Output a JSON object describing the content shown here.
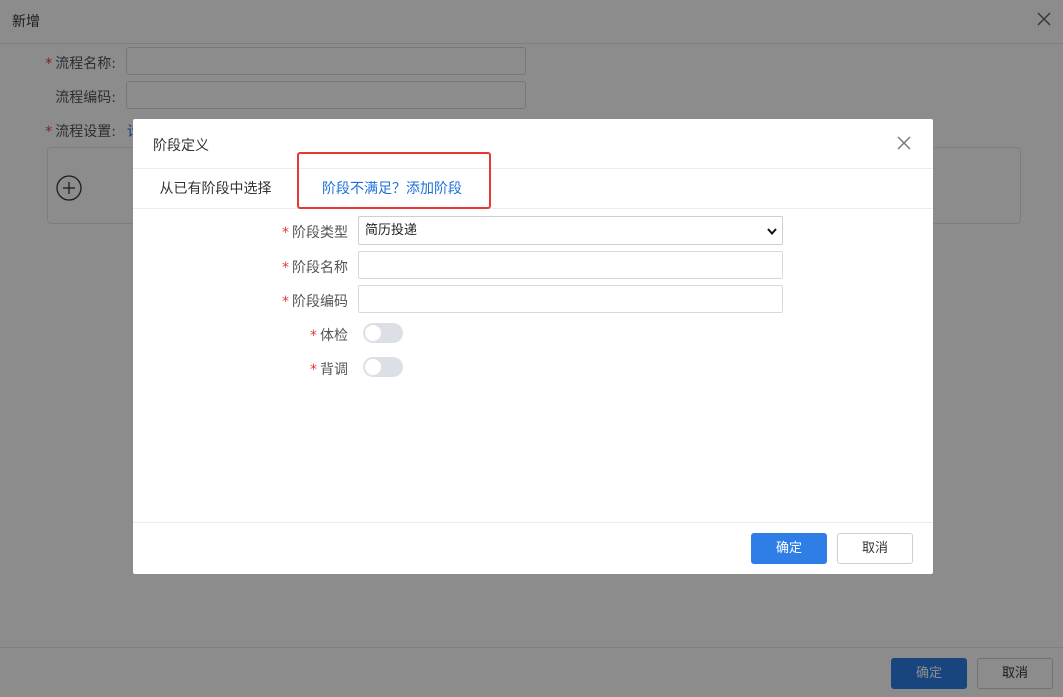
{
  "page": {
    "title": "新增",
    "fields": [
      {
        "label": "流程名称:",
        "required": true,
        "value": ""
      },
      {
        "label": "流程编码:",
        "required": false,
        "value": ""
      }
    ],
    "flow_settings_label": "流程设置:",
    "flow_settings_required": true,
    "flow_settings_link": "请",
    "confirm_label": "确定",
    "cancel_label": "取消"
  },
  "dialog": {
    "title": "阶段定义",
    "tabs": [
      {
        "label": "从已有阶段中选择"
      },
      {
        "label": "阶段不满足？添加阶段"
      }
    ],
    "required_mark": "*",
    "fields": {
      "stage_type": {
        "label": "阶段类型",
        "value": "简历投递"
      },
      "stage_name": {
        "label": "阶段名称",
        "value": ""
      },
      "stage_code": {
        "label": "阶段编码",
        "value": ""
      },
      "physical_exam": {
        "label": "体检",
        "on": false
      },
      "background_check": {
        "label": "背调",
        "on": false
      }
    },
    "confirm_label": "确定",
    "cancel_label": "取消"
  },
  "colors": {
    "primary": "#2f7ee8",
    "link": "#1e6fd9",
    "required": "#e53935",
    "highlight_box": "#e53935",
    "overlay": "rgba(0,0,0,0.45)"
  }
}
